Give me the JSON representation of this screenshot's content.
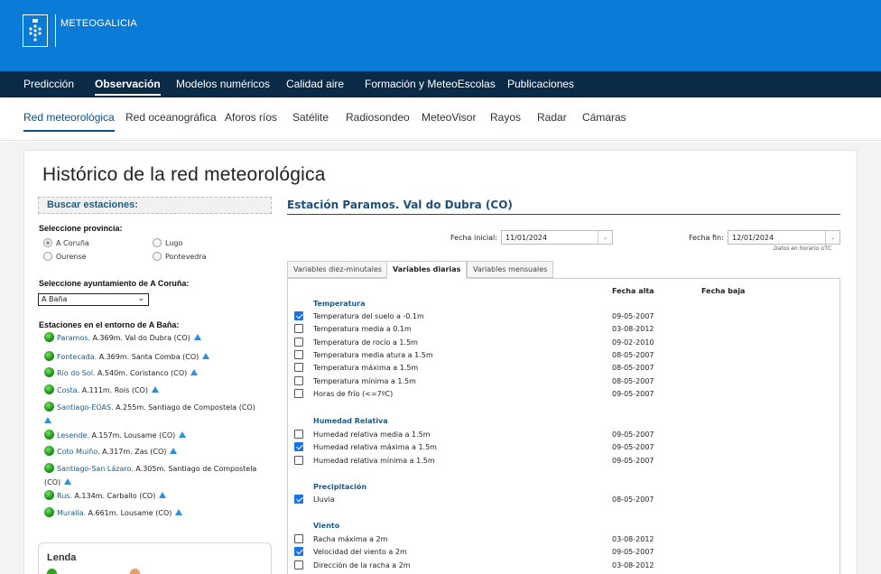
{
  "header": {
    "brand": "METEOGALICIA",
    "logo_icon": "galicia-coat-of-arms-icon",
    "bg_color": "#0a7bd6"
  },
  "main_nav": {
    "items": [
      {
        "label": "Predicción",
        "active": false
      },
      {
        "label": "Observación",
        "active": true
      },
      {
        "label": "Modelos numéricos",
        "active": false
      },
      {
        "label": "Calidad aire",
        "active": false
      },
      {
        "label": "Formación y MeteoEscolas",
        "active": false
      },
      {
        "label": "Publicaciones",
        "active": false
      }
    ],
    "bg_color": "#0b2a45"
  },
  "sub_nav": {
    "items": [
      {
        "label": "Red meteorológica",
        "active": true
      },
      {
        "label": "Red oceanográfica",
        "active": false
      },
      {
        "label": "Aforos ríos",
        "active": false
      },
      {
        "label": "Satélite",
        "active": false
      },
      {
        "label": "Radiosondeo",
        "active": false
      },
      {
        "label": "MeteoVisor",
        "active": false
      },
      {
        "label": "Rayos",
        "active": false
      },
      {
        "label": "Radar",
        "active": false
      },
      {
        "label": "Cámaras",
        "active": false
      }
    ]
  },
  "page_title": "Histórico de la red meteorológica",
  "search": {
    "title": "Buscar estaciones:",
    "province_label": "Seleccione provincia:",
    "provinces": [
      {
        "label": "A Coruña",
        "checked": true
      },
      {
        "label": "Lugo",
        "checked": false
      },
      {
        "label": "Ourense",
        "checked": false
      },
      {
        "label": "Pontevedra",
        "checked": false
      }
    ],
    "municipality_label": "Seleccione ayuntamiento de  A Coruña:",
    "municipality_value": "A Baña",
    "stations_label": "Estaciones en el entorno de A Baña:",
    "stations": [
      {
        "name": "Paramos.",
        "info": " A.369m. Val do Dubra (CO)"
      },
      {
        "name": "Fontecada.",
        "info": " A.369m. Santa Comba (CO)"
      },
      {
        "name": "Rio do Sol.",
        "info": " A.540m. Coristanco (CO)"
      },
      {
        "name": "Costa.",
        "info": " A.111m. Rois (CO)"
      },
      {
        "name": "Santiago-EOAS.",
        "info": " A.255m. Santiago de Compostela (CO)"
      },
      {
        "name": "Lesende.",
        "info": " A.157m. Lousame (CO)"
      },
      {
        "name": "Coto Muiño.",
        "info": " A.317m. Zas (CO)"
      },
      {
        "name": "Santiago-San Lázaro.",
        "info": " A.305m. Santiago de Compostela (CO)"
      },
      {
        "name": "Rus.",
        "info": " A.134m. Carballo (CO)"
      },
      {
        "name": "Muralla.",
        "info": " A.661m. Lousame (CO)"
      }
    ],
    "legend_title": "Lenda"
  },
  "station": {
    "title": "Estación  Paramos. Val do Dubra (CO)",
    "start_label": "Fecha inicial:",
    "start_value": "11/01/2024",
    "end_label": "Fecha fin:",
    "end_value": "12/01/2024",
    "utc_note": "Datos en horario UTC",
    "tabs": [
      {
        "label": "Variables diez-minutales",
        "active": false
      },
      {
        "label": "Variables diarias",
        "active": true
      },
      {
        "label": "Variables mensuales",
        "active": false
      }
    ],
    "col_alta": "Fecha alta",
    "col_baja": "Fecha baja",
    "groups": [
      {
        "title": "Temperatura",
        "rows": [
          {
            "name": "Temperatura del suelo a -0.1m",
            "alta": "09-05-2007",
            "checked": true
          },
          {
            "name": "Temperatura media a 0.1m",
            "alta": "03-08-2012",
            "checked": false
          },
          {
            "name": "Temperatura de rocío a 1.5m",
            "alta": "09-02-2010",
            "checked": false
          },
          {
            "name": "Temperatura media atura a 1.5m",
            "alta": "08-05-2007",
            "checked": false
          },
          {
            "name": "Temperatura máxima a 1.5m",
            "alta": "08-05-2007",
            "checked": false
          },
          {
            "name": "Temperatura mínima a 1.5m",
            "alta": "08-05-2007",
            "checked": false
          },
          {
            "name": "Horas de frío (<=7ºC)",
            "alta": "09-05-2007",
            "checked": false
          }
        ]
      },
      {
        "title": "Humedad Relativa",
        "rows": [
          {
            "name": "Humedad relativa media a 1.5m",
            "alta": "09-05-2007",
            "checked": false
          },
          {
            "name": "Humedad relativa  máxima a 1.5m",
            "alta": "09-05-2007",
            "checked": true
          },
          {
            "name": "Humedad relativa  mínima a 1.5m",
            "alta": "09-05-2007",
            "checked": false
          }
        ]
      },
      {
        "title": "Precipitación",
        "rows": [
          {
            "name": "Lluvia",
            "alta": "08-05-2007",
            "checked": true
          }
        ]
      },
      {
        "title": "Viento",
        "rows": [
          {
            "name": "Racha máxima a 2m",
            "alta": "03-08-2012",
            "checked": false
          },
          {
            "name": "Velocidad del viento a 2m",
            "alta": "09-05-2007",
            "checked": true
          },
          {
            "name": "Dirección de la racha a 2m",
            "alta": "03-08-2012",
            "checked": false
          }
        ]
      }
    ]
  }
}
